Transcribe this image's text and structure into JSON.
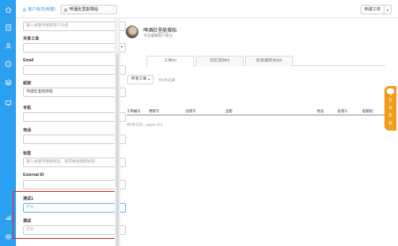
{
  "colors": {
    "rail": "#2b9ff0",
    "accent": "#2b9ff0",
    "highlight_border": "#e51c23",
    "chat_widget": "#f49b18"
  },
  "rail_icons": [
    "home-icon",
    "document-icon",
    "customers-icon",
    "message-icon",
    "layers-icon",
    "monitor-icon",
    "chart-icon",
    "settings-icon"
  ],
  "topbar": {
    "tabs": [
      {
        "label": "客户信息(新建)",
        "icon": "user-icon",
        "active": true
      },
      {
        "label": "啤酒肚里能撑船",
        "icon": "user-icon",
        "active": false
      }
    ],
    "new_ticket_label": "新建工单"
  },
  "form": {
    "org_placeholder": "输入关键字搜索客户分组",
    "shared_ticket_label": "共享工单",
    "email_label": "Email",
    "nickname_label": "昵称",
    "nickname_value": "啤酒肚里能撑船",
    "phone_label": "手机",
    "tel_label": "电话",
    "tags_label": "标签",
    "tags_placeholder": "输入关键字搜索标签，按空格创建新标签",
    "external_id_label": "External ID",
    "test1_label": "测试1",
    "test1_placeholder": "打分",
    "test_label": "测试",
    "test_placeholder": "打分"
  },
  "customer": {
    "name": "啤酒肚里能撑船",
    "note_placeholder": "点击编辑客户备注"
  },
  "subtabs": [
    {
      "label": "工单(0)",
      "active": true
    },
    {
      "label": "社区活动(0)",
      "active": false
    },
    {
      "label": "会话(最新访)(0)",
      "active": false
    }
  ],
  "filter": {
    "label": "所有工单",
    "records": "共0条记录"
  },
  "table": {
    "columns": [
      "工单编号",
      "更新于",
      "创建于",
      "主题",
      "状态",
      "处理人",
      "客服组"
    ]
  },
  "pagination": "共0条记录，page1 of 0",
  "chat_widget": {
    "label_chars": [
      "在",
      "线",
      "客",
      "服"
    ]
  }
}
